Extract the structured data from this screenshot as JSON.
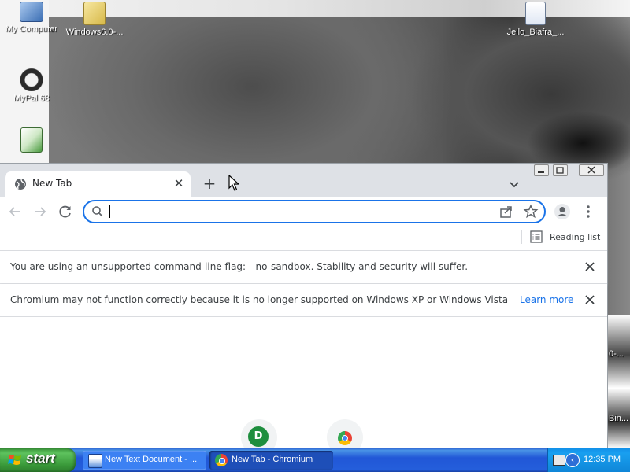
{
  "desktop": {
    "icons": [
      {
        "label": "My Computer"
      },
      {
        "label": "Windows6.0-..."
      },
      {
        "label": "MyPal 68"
      },
      {
        "label": "Jello_Biafra_..."
      }
    ],
    "right_fragments": [
      "0-...",
      "Bin..."
    ]
  },
  "browser": {
    "tab": {
      "title": "New Tab"
    },
    "omnibox": {
      "value": "",
      "placeholder": ""
    },
    "bookmarks_bar": {
      "reading_list_label": "Reading list"
    },
    "infobars": [
      {
        "message": "You are using an unsupported command-line flag: --no-sandbox. Stability and security will suffer."
      },
      {
        "message": "Chromium may not function correctly because it is no longer supported on Windows XP or Windows Vista",
        "link": "Learn more"
      }
    ],
    "shortcuts": [
      {
        "letter": "D"
      }
    ]
  },
  "taskbar": {
    "start_label": "start",
    "tasks": [
      {
        "label": "New Text Document - ..."
      },
      {
        "label": "New Tab - Chromium"
      }
    ],
    "clock": "12:35 PM"
  },
  "colors": {
    "accent": "#1a73e8",
    "tabstrip": "#dee1e6",
    "taskbar": "#245edb",
    "start_button": "#3a9a3a"
  }
}
